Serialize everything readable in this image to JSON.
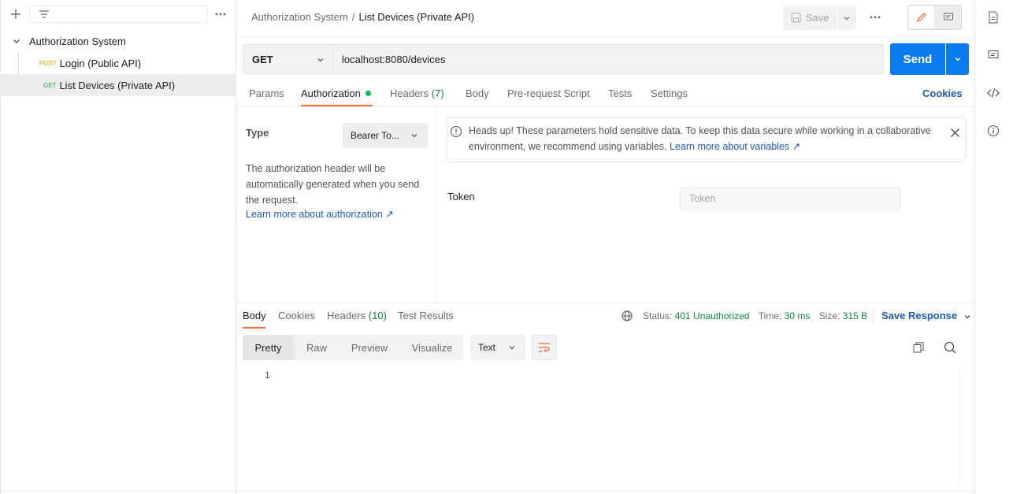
{
  "sidebar": {
    "collection_name": "Authorization System",
    "items": [
      {
        "method": "POST",
        "label": "Login (Public API)"
      },
      {
        "method": "GET",
        "label": "List Devices (Private API)"
      }
    ]
  },
  "header": {
    "breadcrumb_parent": "Authorization System",
    "breadcrumb_sep": "/",
    "breadcrumb_current": "List Devices (Private API)",
    "save_label": "Save"
  },
  "request": {
    "method": "GET",
    "url": "localhost:8080/devices",
    "send_label": "Send",
    "tabs": [
      "Params",
      "Authorization",
      "Headers",
      "Body",
      "Pre-request Script",
      "Tests",
      "Settings"
    ],
    "headers_count": "(7)",
    "cookies_label": "Cookies"
  },
  "auth": {
    "type_label": "Type",
    "type_value": "Bearer To...",
    "description": "The authorization header will be automatically generated when you send the request.",
    "learn_more": "Learn more about authorization ↗",
    "alert_text": "Heads up! These parameters hold sensitive data. To keep this data secure while working in a collaborative environment, we recommend using variables.",
    "alert_link": "Learn more about variables ↗",
    "token_label": "Token",
    "token_placeholder": "Token"
  },
  "response": {
    "tabs": [
      "Body",
      "Cookies",
      "Headers",
      "Test Results"
    ],
    "headers_count": "(10)",
    "status_label": "Status:",
    "status_value": "401 Unauthorized",
    "time_label": "Time:",
    "time_value": "30 ms",
    "size_label": "Size:",
    "size_value": "315 B",
    "save_response": "Save Response",
    "views": [
      "Pretty",
      "Raw",
      "Preview",
      "Visualize"
    ],
    "format": "Text",
    "line_number": "1"
  },
  "colors": {
    "accent_orange": "#f26b3a",
    "send_blue": "#097bed",
    "link_blue": "#1c59b8",
    "success_green": "#0b8a3c",
    "post_yellow": "#d6a300",
    "get_green": "#2a9d55"
  }
}
